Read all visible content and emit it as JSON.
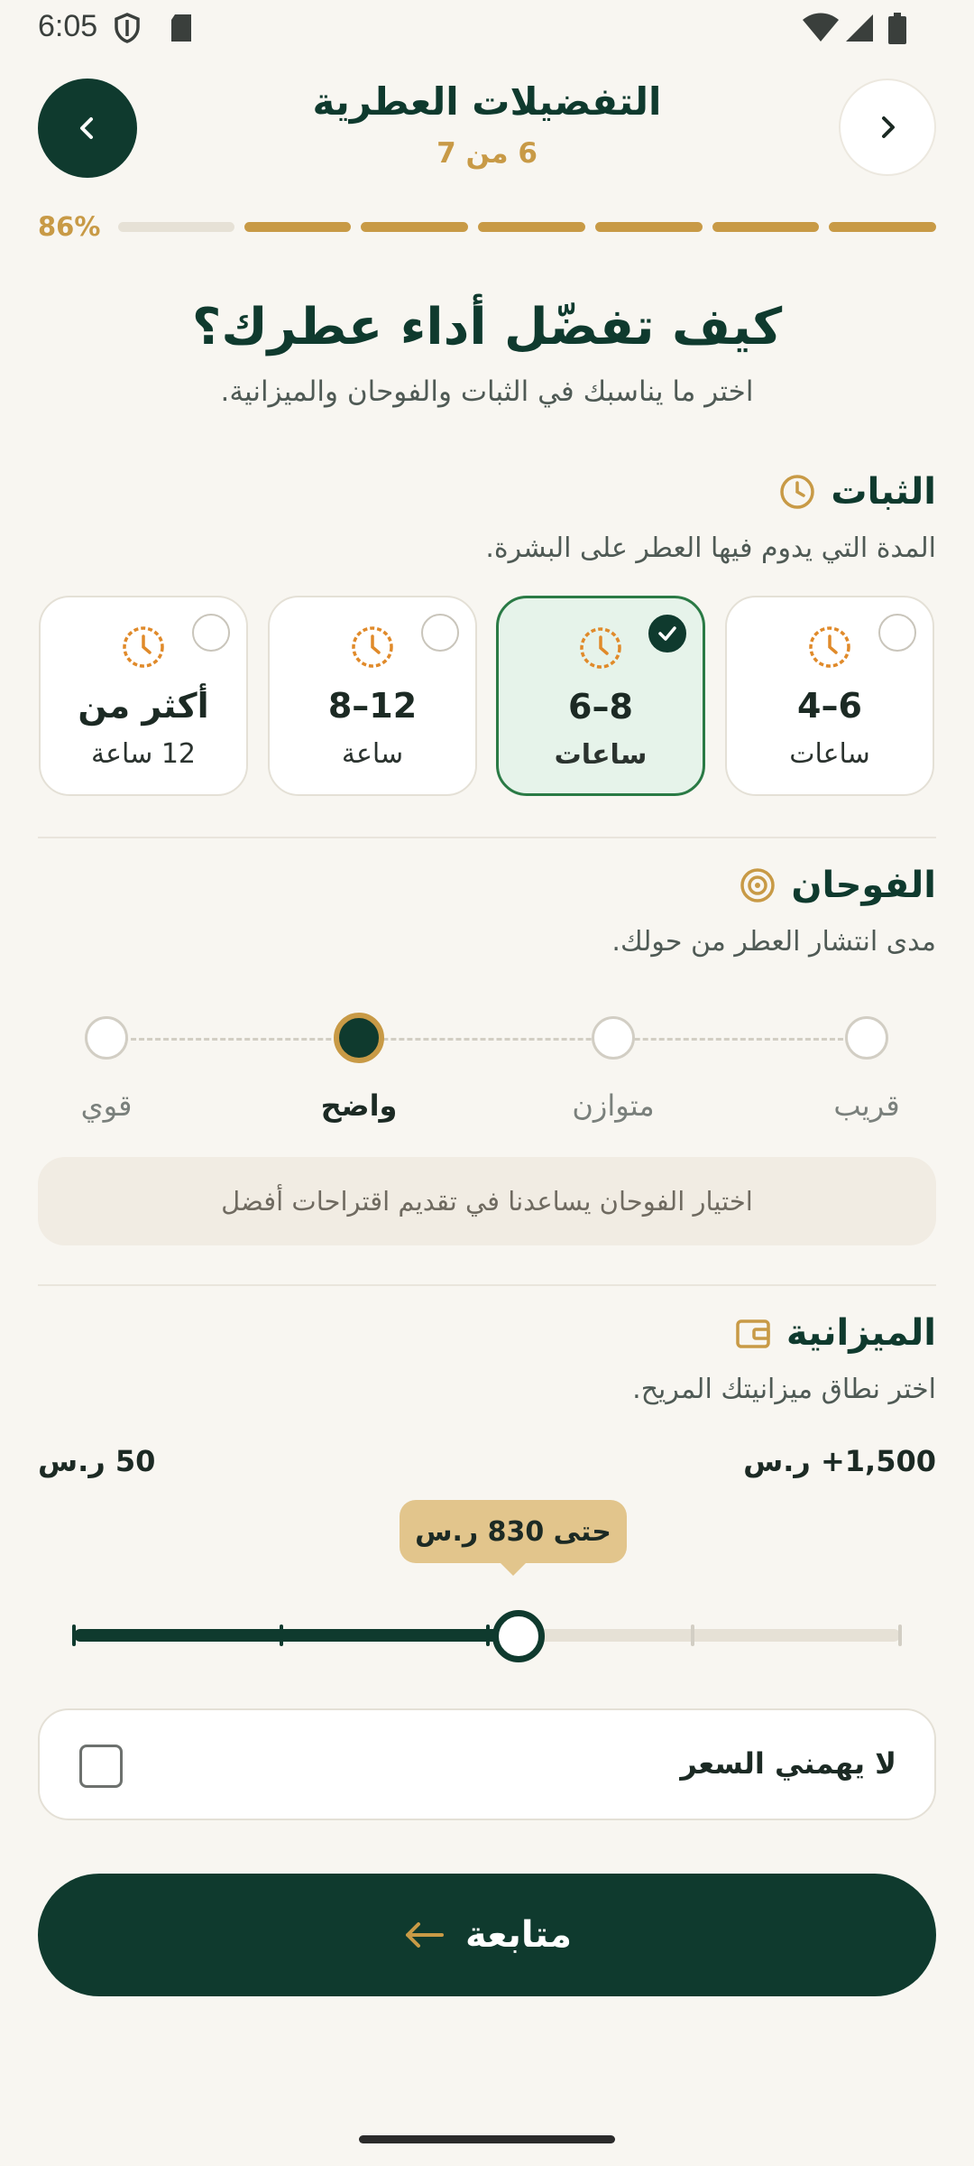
{
  "status_bar": {
    "time": "6:05"
  },
  "header": {
    "title": "التفضيلات العطرية",
    "step": "6 من 7"
  },
  "progress": {
    "percent_label": "86%",
    "value": 0.86,
    "segments_total": 7,
    "segments_done": 6
  },
  "question": {
    "title": "كيف تفضّل أداء عطرك؟",
    "subtitle": "اختر ما يناسبك في الثبات والفوحان والميزانية."
  },
  "longevity": {
    "title": "الثبات",
    "description": "المدة التي يدوم فيها العطر على البشرة.",
    "options": [
      {
        "value": "4–6",
        "unit": "ساعات",
        "selected": false
      },
      {
        "value": "6–8",
        "unit": "ساعات",
        "selected": true
      },
      {
        "value": "8–12",
        "unit": "ساعة",
        "selected": false
      },
      {
        "value": "أكثر من",
        "unit": "12 ساعة",
        "selected": false
      }
    ]
  },
  "sillage": {
    "title": "الفوحان",
    "description": "مدى انتشار العطر من حولك.",
    "options": [
      "قريب",
      "متوازن",
      "واضح",
      "قوي"
    ],
    "selected": "واضح",
    "hint": "اختيار الفوحان يساعدنا في تقديم اقتراحات أفضل"
  },
  "budget": {
    "title": "الميزانية",
    "description": "اختر نطاق ميزانيتك المريح.",
    "min_label": "50 ر.س",
    "max_label": "1,500+ ر.س",
    "tooltip": "حتى 830 ر.س",
    "value": 830,
    "no_price_label": "لا يهمني السعر",
    "no_price_checked": false
  },
  "cta": {
    "label": "متابعة"
  },
  "colors": {
    "primary": "#0f3a2e",
    "accent": "#c89a46",
    "clock": "#e08a2a",
    "selected_bg": "#e6f3ea",
    "selected_border": "#2a7a45"
  }
}
